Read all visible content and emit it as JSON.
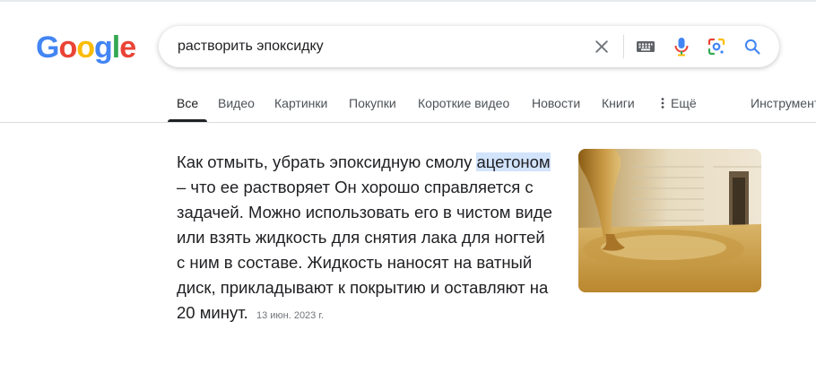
{
  "logo": {
    "letters": [
      "G",
      "o",
      "o",
      "g",
      "l",
      "e"
    ],
    "colors": [
      "#4285F4",
      "#EA4335",
      "#FBBC05",
      "#4285F4",
      "#34A853",
      "#EA4335"
    ]
  },
  "search": {
    "query": "растворить эпоксидку"
  },
  "icons": {
    "clear": "close-icon",
    "keyboard": "keyboard-icon",
    "mic": "microphone-icon",
    "lens": "google-lens-icon",
    "search": "search-icon"
  },
  "tabs": [
    {
      "label": "Все",
      "active": true
    },
    {
      "label": "Видео"
    },
    {
      "label": "Картинки"
    },
    {
      "label": "Покупки"
    },
    {
      "label": "Короткие видео"
    },
    {
      "label": "Новости"
    },
    {
      "label": "Книги"
    },
    {
      "label": "Ещё",
      "icon": "more-vert-icon"
    },
    {
      "label": "Инструменты"
    }
  ],
  "snippet": {
    "pre": "Как отмыть, убрать эпоксидную смолу",
    "highlight": "ацетоном",
    "body": " – что ее растворяет Он хорошо справляется с задачей. Можно использовать его в чистом виде или взять жидкость для снятия лака для ногтей с ним в составе. Жидкость наносят на ватный диск, прикладывают к покрытию и оставляют на 20 минут.",
    "date": "13 июн. 2023 г."
  },
  "colors": {
    "highlight": "#d2e3fc",
    "accent_blue": "#4285F4"
  }
}
